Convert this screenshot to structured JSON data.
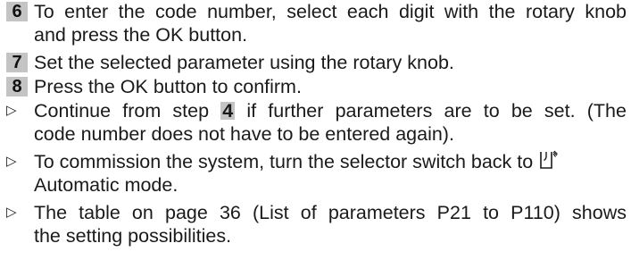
{
  "steps": [
    {
      "number": "6",
      "line1": "To enter the code number, select each digit with the rotary knob",
      "line2": "and press the OK button."
    },
    {
      "number": "7",
      "line1": "Set the selected parameter using the rotary knob."
    },
    {
      "number": "8",
      "line1": "Press the OK button to confirm."
    }
  ],
  "bullets": [
    {
      "symbol": "▷",
      "line1_before": "Continue from step",
      "line1_step": "4",
      "line1_after": "if further parameters are to be set. (The",
      "line2": "code number does not have to be entered again)."
    },
    {
      "symbol": "▷",
      "line1": "To commission the system, turn the selector switch back to",
      "icon": "automatic-mode-icon",
      "line2": "Automatic mode."
    },
    {
      "symbol": "▷",
      "line1": "The table on page 36 (List of parameters P21 to P110) shows",
      "line2": "the setting possibilities."
    }
  ],
  "colors": {
    "badge": "#c4c4c4",
    "text": "#1a1a1a"
  }
}
